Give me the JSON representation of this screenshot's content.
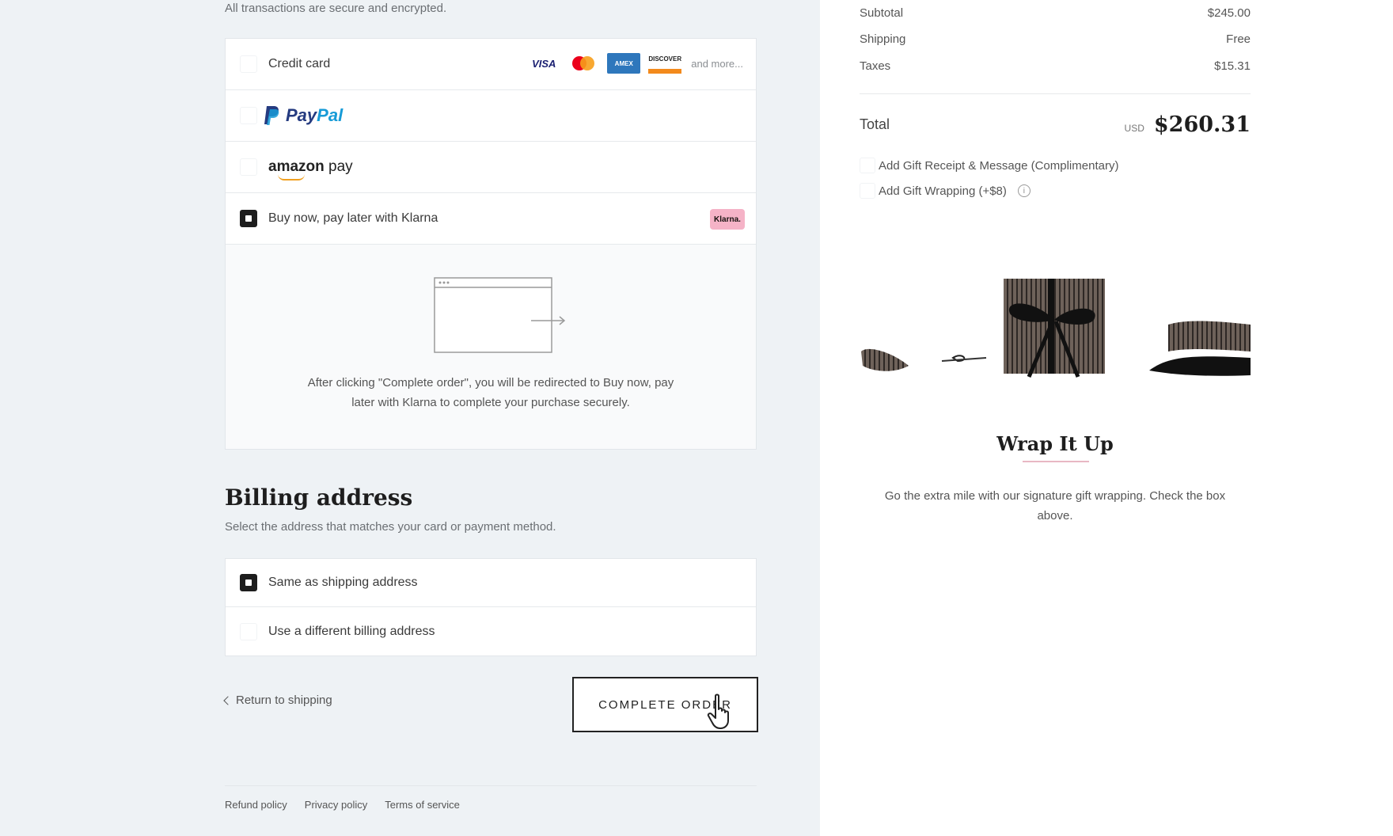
{
  "payment": {
    "secure_note": "All transactions are secure and encrypted.",
    "credit_card_label": "Credit card",
    "card_logos": {
      "visa": "VISA",
      "amex": "AMEX",
      "discover": "DISCOVER",
      "more": "and more..."
    },
    "paypal": {
      "pay": "Pay",
      "pal": "Pal"
    },
    "amazon": {
      "amazon": "amazon",
      "pay": " pay"
    },
    "klarna_label": "Buy now, pay later with Klarna",
    "klarna_badge": "Klarna.",
    "redirect_text": "After clicking \"Complete order\", you will be redirected to Buy now, pay later with Klarna to complete your purchase securely.",
    "selected": "klarna"
  },
  "billing": {
    "title": "Billing address",
    "subtitle": "Select the address that matches your card or payment method.",
    "options": [
      {
        "label": "Same as shipping address",
        "checked": true
      },
      {
        "label": "Use a different billing address",
        "checked": false
      }
    ]
  },
  "actions": {
    "return_label": "Return to shipping",
    "complete_label": "COMPLETE ORDER"
  },
  "footer": {
    "links": [
      "Refund policy",
      "Privacy policy",
      "Terms of service"
    ]
  },
  "summary": {
    "subtotal_label": "Subtotal",
    "subtotal_value": "$245.00",
    "shipping_label": "Shipping",
    "shipping_value": "Free",
    "taxes_label": "Taxes",
    "taxes_value": "$15.31",
    "total_label": "Total",
    "currency": "USD",
    "total_value": "$260.31",
    "gift_receipt_label": "Add Gift Receipt & Message (Complimentary)",
    "gift_wrap_label": "Add Gift Wrapping (+$8)",
    "info_glyph": "i"
  },
  "promo": {
    "title": "Wrap It Up",
    "text": "Go the extra mile with our signature gift wrapping. Check the box above."
  },
  "colors": {
    "page_bg": "#eef2f5",
    "klarna_pink": "#f5b3c7",
    "paypal_dark": "#253b80",
    "paypal_light": "#179bd7"
  }
}
